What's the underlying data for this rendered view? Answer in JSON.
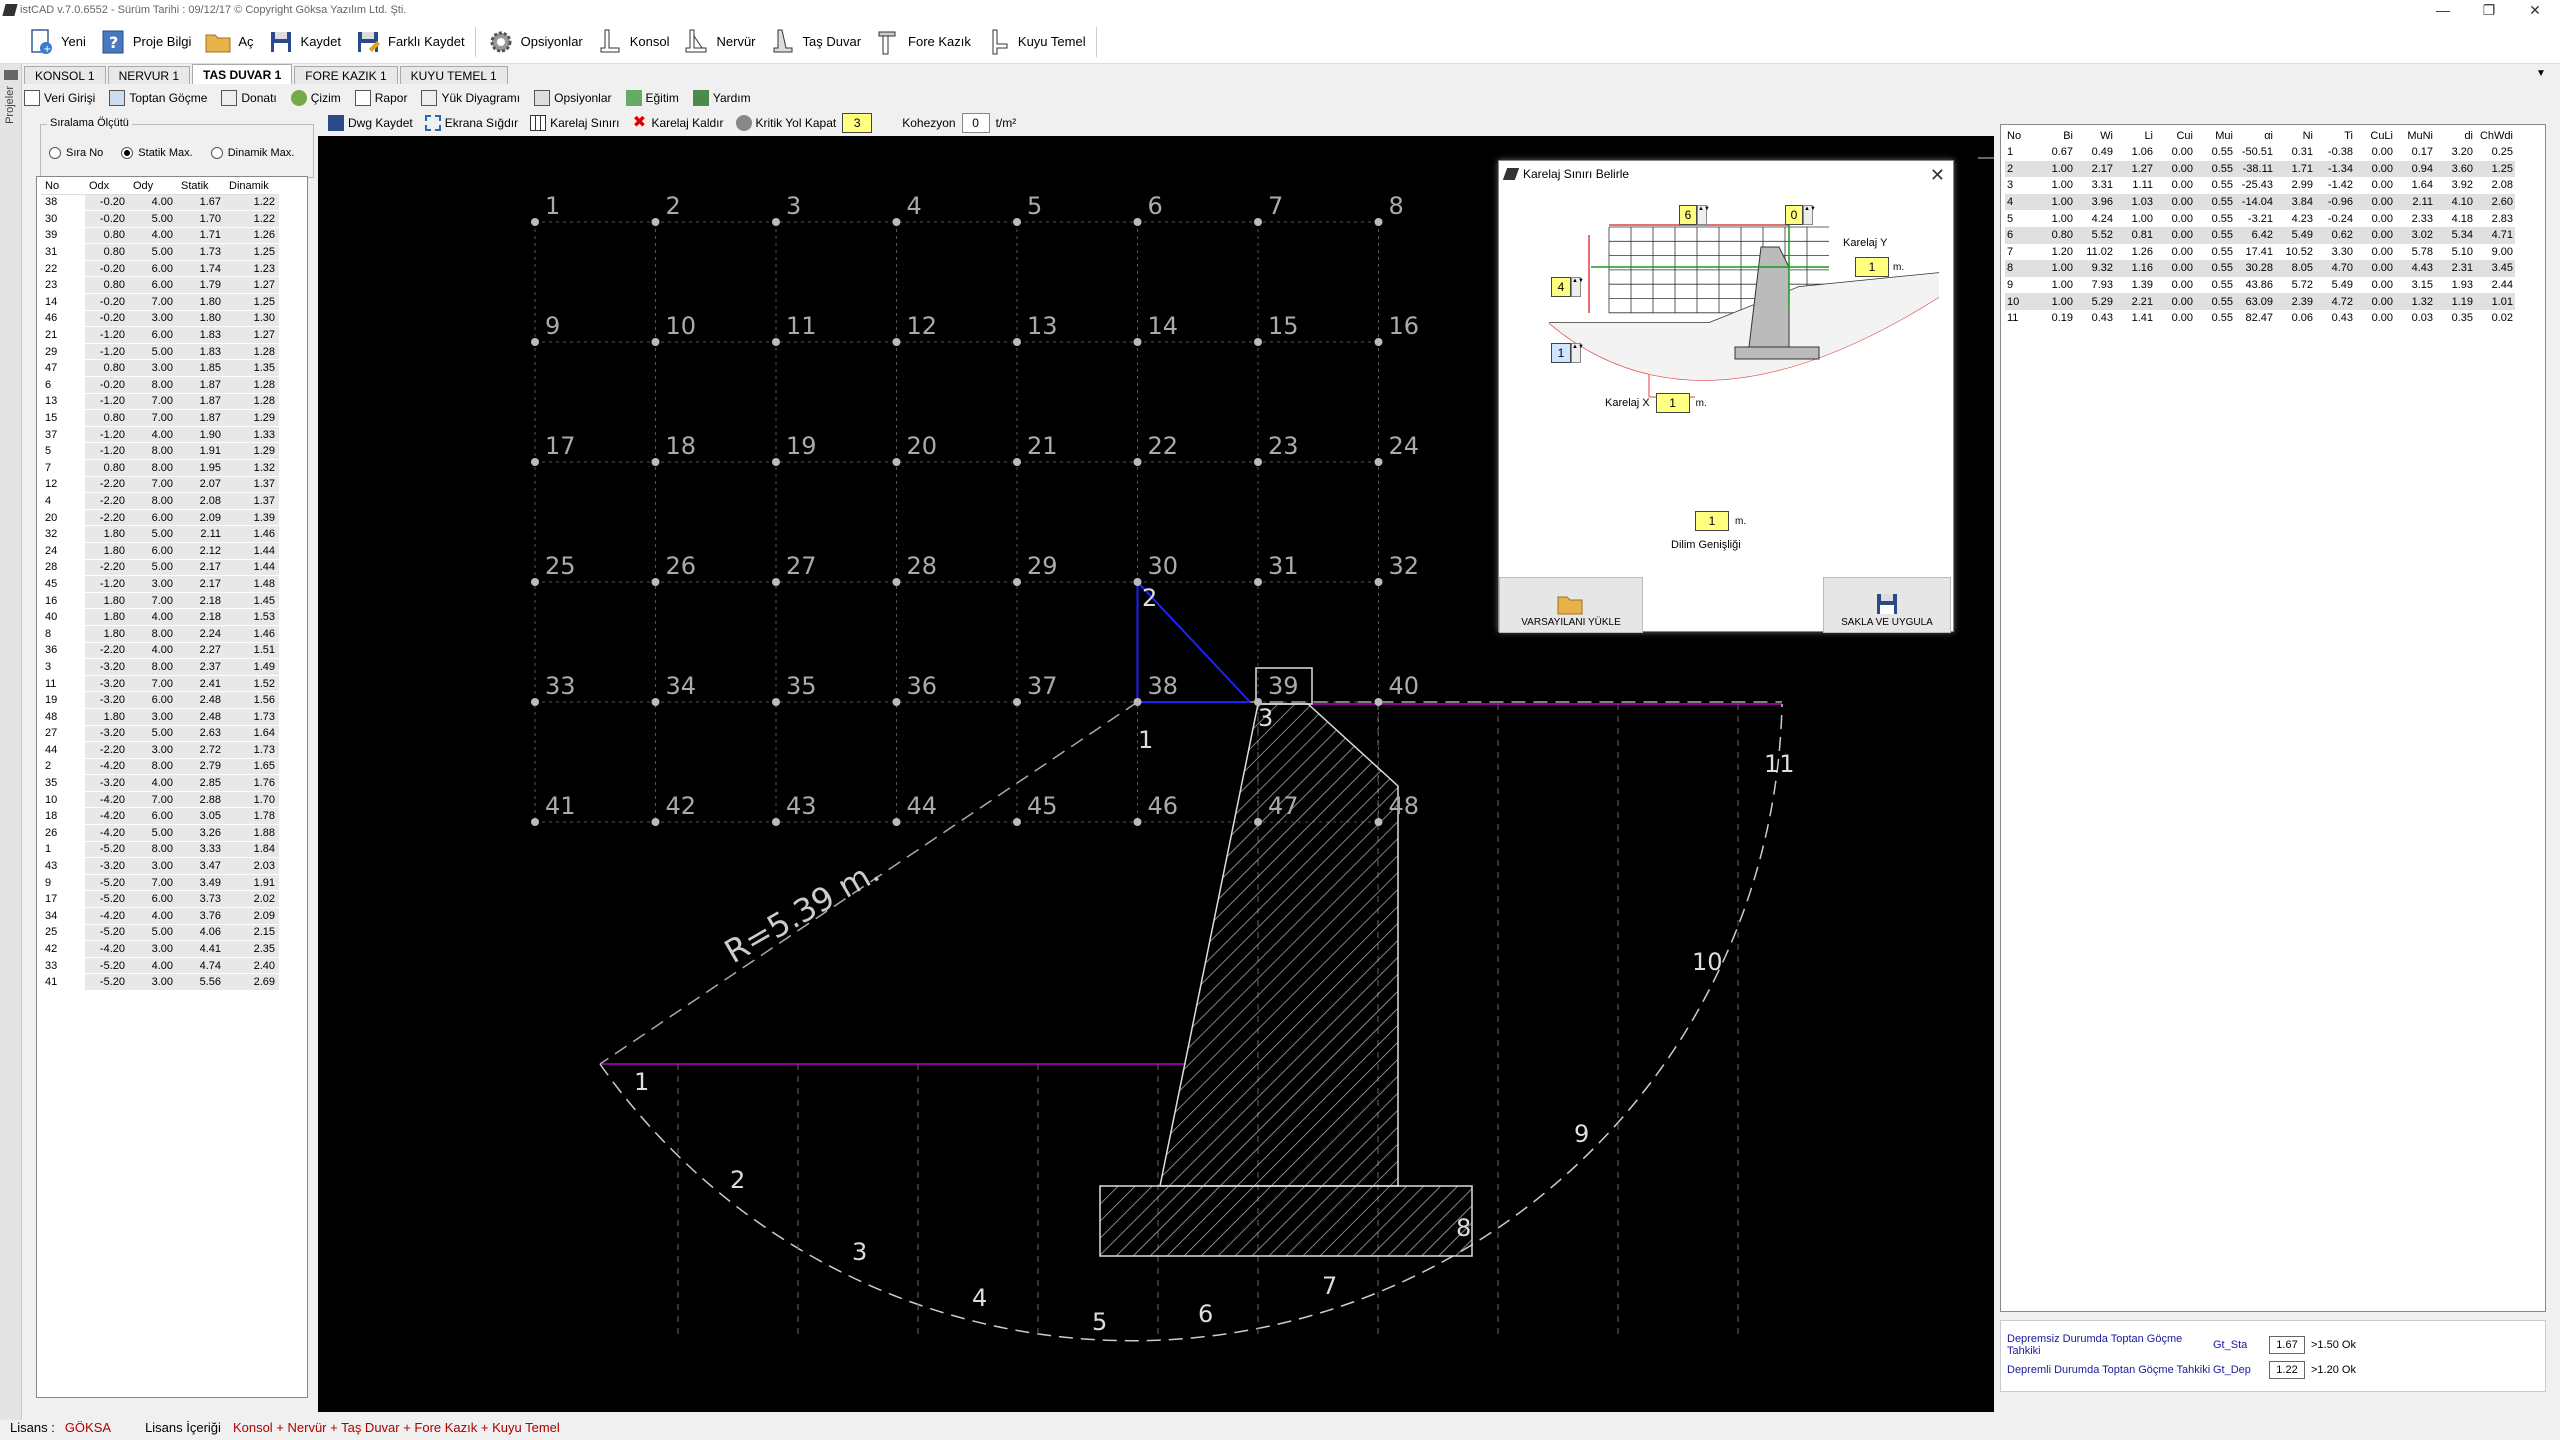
{
  "app": {
    "title": "istCAD v.7.0.6552 - Sürüm Tarihi : 09/12/17  © Copyright Göksa Yazılım Ltd. Şti."
  },
  "toolbar": [
    {
      "id": "yeni",
      "label": "Yeni",
      "icon": "new-document-icon"
    },
    {
      "id": "proje-bilgi",
      "label": "Proje Bilgi",
      "icon": "info-icon"
    },
    {
      "id": "ac",
      "label": "Aç",
      "icon": "folder-open-icon"
    },
    {
      "id": "kaydet",
      "label": "Kaydet",
      "icon": "save-icon"
    },
    {
      "id": "farkli-kaydet",
      "label": "Farklı Kaydet",
      "icon": "save-as-icon"
    },
    {
      "id": "opsiyonlar",
      "label": "Opsiyonlar",
      "icon": "gear-icon"
    },
    {
      "id": "konsol",
      "label": "Konsol",
      "icon": "console-wall-icon"
    },
    {
      "id": "nervur",
      "label": "Nervür",
      "icon": "rib-wall-icon"
    },
    {
      "id": "tas-duvar",
      "label": "Taş Duvar",
      "icon": "stone-wall-icon"
    },
    {
      "id": "fore-kazik",
      "label": "Fore Kazık",
      "icon": "pile-icon"
    },
    {
      "id": "kuyu-temel",
      "label": "Kuyu Temel",
      "icon": "well-foundation-icon"
    }
  ],
  "tabs": [
    "KONSOL 1",
    "NERVUR 1",
    "TAS DUVAR 1",
    "FORE KAZIK 1",
    "KUYU TEMEL 1"
  ],
  "active_tab": "TAS DUVAR 1",
  "subtoolbar": [
    "Veri Girişi",
    "Toptan Göçme",
    "Donatı",
    "Çizim",
    "Rapor",
    "Yük Diyagramı",
    "Opsiyonlar",
    "Eğitim",
    "Yardım"
  ],
  "drawing_toolbar": {
    "items": [
      "Dwg Kaydet",
      "Ekrana Sığdır",
      "Karelaj Sınırı",
      "Karelaj Kaldır",
      "Kritik Yol Kapat"
    ],
    "kritik_value": "3",
    "kohezyon_label": "Kohezyon",
    "kohezyon_value": "0",
    "kohezyon_unit": "t/m²"
  },
  "sorting": {
    "title": "Sıralama Ölçütü",
    "options": [
      "Sıra No",
      "Statik Max.",
      "Dinamik Max."
    ],
    "selected": "Statik Max."
  },
  "left_table": {
    "headers": [
      "No",
      "Odx",
      "Ody",
      "Statik",
      "Dinamik"
    ],
    "rows": [
      [
        "38",
        "-0.20",
        "4.00",
        "1.67",
        "1.22"
      ],
      [
        "30",
        "-0.20",
        "5.00",
        "1.70",
        "1.22"
      ],
      [
        "39",
        "0.80",
        "4.00",
        "1.71",
        "1.26"
      ],
      [
        "31",
        "0.80",
        "5.00",
        "1.73",
        "1.25"
      ],
      [
        "22",
        "-0.20",
        "6.00",
        "1.74",
        "1.23"
      ],
      [
        "23",
        "0.80",
        "6.00",
        "1.79",
        "1.27"
      ],
      [
        "14",
        "-0.20",
        "7.00",
        "1.80",
        "1.25"
      ],
      [
        "46",
        "-0.20",
        "3.00",
        "1.80",
        "1.30"
      ],
      [
        "21",
        "-1.20",
        "6.00",
        "1.83",
        "1.27"
      ],
      [
        "29",
        "-1.20",
        "5.00",
        "1.83",
        "1.28"
      ],
      [
        "47",
        "0.80",
        "3.00",
        "1.85",
        "1.35"
      ],
      [
        "6",
        "-0.20",
        "8.00",
        "1.87",
        "1.28"
      ],
      [
        "13",
        "-1.20",
        "7.00",
        "1.87",
        "1.28"
      ],
      [
        "15",
        "0.80",
        "7.00",
        "1.87",
        "1.29"
      ],
      [
        "37",
        "-1.20",
        "4.00",
        "1.90",
        "1.33"
      ],
      [
        "5",
        "-1.20",
        "8.00",
        "1.91",
        "1.29"
      ],
      [
        "7",
        "0.80",
        "8.00",
        "1.95",
        "1.32"
      ],
      [
        "12",
        "-2.20",
        "7.00",
        "2.07",
        "1.37"
      ],
      [
        "4",
        "-2.20",
        "8.00",
        "2.08",
        "1.37"
      ],
      [
        "20",
        "-2.20",
        "6.00",
        "2.09",
        "1.39"
      ],
      [
        "32",
        "1.80",
        "5.00",
        "2.11",
        "1.46"
      ],
      [
        "24",
        "1.80",
        "6.00",
        "2.12",
        "1.44"
      ],
      [
        "28",
        "-2.20",
        "5.00",
        "2.17",
        "1.44"
      ],
      [
        "45",
        "-1.20",
        "3.00",
        "2.17",
        "1.48"
      ],
      [
        "16",
        "1.80",
        "7.00",
        "2.18",
        "1.45"
      ],
      [
        "40",
        "1.80",
        "4.00",
        "2.18",
        "1.53"
      ],
      [
        "8",
        "1.80",
        "8.00",
        "2.24",
        "1.46"
      ],
      [
        "36",
        "-2.20",
        "4.00",
        "2.27",
        "1.51"
      ],
      [
        "3",
        "-3.20",
        "8.00",
        "2.37",
        "1.49"
      ],
      [
        "11",
        "-3.20",
        "7.00",
        "2.41",
        "1.52"
      ],
      [
        "19",
        "-3.20",
        "6.00",
        "2.48",
        "1.56"
      ],
      [
        "48",
        "1.80",
        "3.00",
        "2.48",
        "1.73"
      ],
      [
        "27",
        "-3.20",
        "5.00",
        "2.63",
        "1.64"
      ],
      [
        "44",
        "-2.20",
        "3.00",
        "2.72",
        "1.73"
      ],
      [
        "2",
        "-4.20",
        "8.00",
        "2.79",
        "1.65"
      ],
      [
        "35",
        "-3.20",
        "4.00",
        "2.85",
        "1.76"
      ],
      [
        "10",
        "-4.20",
        "7.00",
        "2.88",
        "1.70"
      ],
      [
        "18",
        "-4.20",
        "6.00",
        "3.05",
        "1.78"
      ],
      [
        "26",
        "-4.20",
        "5.00",
        "3.26",
        "1.88"
      ],
      [
        "1",
        "-5.20",
        "8.00",
        "3.33",
        "1.84"
      ],
      [
        "43",
        "-3.20",
        "3.00",
        "3.47",
        "2.03"
      ],
      [
        "9",
        "-5.20",
        "7.00",
        "3.49",
        "1.91"
      ],
      [
        "17",
        "-5.20",
        "6.00",
        "3.73",
        "2.02"
      ],
      [
        "34",
        "-4.20",
        "4.00",
        "3.76",
        "2.09"
      ],
      [
        "25",
        "-5.20",
        "5.00",
        "4.06",
        "2.15"
      ],
      [
        "42",
        "-4.20",
        "3.00",
        "4.41",
        "2.35"
      ],
      [
        "33",
        "-5.20",
        "4.00",
        "4.74",
        "2.40"
      ],
      [
        "41",
        "-5.20",
        "3.00",
        "5.56",
        "2.69"
      ]
    ]
  },
  "drawing": {
    "radius_label": "R=5.39 m.",
    "grid_labels": [
      "1",
      "2",
      "3",
      "4",
      "5",
      "6",
      "7",
      "8",
      "9",
      "10",
      "11",
      "12",
      "13",
      "14",
      "15",
      "16",
      "17",
      "18",
      "19",
      "20",
      "21",
      "22",
      "23",
      "24",
      "25",
      "26",
      "27",
      "28",
      "29",
      "30",
      "31",
      "32",
      "33",
      "34",
      "35",
      "36",
      "37",
      "38",
      "39",
      "40",
      "41",
      "42",
      "43",
      "44",
      "45",
      "46",
      "47",
      "48"
    ],
    "slice_labels": [
      "1",
      "2",
      "3",
      "4",
      "5",
      "6",
      "7",
      "8",
      "9",
      "10",
      "11"
    ],
    "path_labels": [
      "1",
      "2",
      "3"
    ]
  },
  "dialog": {
    "title": "Karelaj Sınırı Belirle",
    "top_left_value": "6",
    "top_right_value": "0",
    "karelaj_y_label": "Karelaj Y",
    "karelaj_y_value": "1",
    "left_upper_value": "4",
    "left_lower_value": "1",
    "karelaj_x_label": "Karelaj X",
    "karelaj_x_value": "1",
    "dilim_value": "1",
    "dilim_label": "Dilim Genişliği",
    "unit": "m.",
    "btn_load": "VARSAYILANI YÜKLE",
    "btn_save": "SAKLA VE UYGULA"
  },
  "right_table": {
    "headers": [
      "No",
      "Bi",
      "Wi",
      "Li",
      "Cui",
      "Mui",
      "αi",
      "Ni",
      "Ti",
      "CuLi",
      "MuNi",
      "di",
      "ChWdi"
    ],
    "rows": [
      [
        "1",
        "0.67",
        "0.49",
        "1.06",
        "0.00",
        "0.55",
        "-50.51",
        "0.31",
        "-0.38",
        "0.00",
        "0.17",
        "3.20",
        "0.25"
      ],
      [
        "2",
        "1.00",
        "2.17",
        "1.27",
        "0.00",
        "0.55",
        "-38.11",
        "1.71",
        "-1.34",
        "0.00",
        "0.94",
        "3.60",
        "1.25"
      ],
      [
        "3",
        "1.00",
        "3.31",
        "1.11",
        "0.00",
        "0.55",
        "-25.43",
        "2.99",
        "-1.42",
        "0.00",
        "1.64",
        "3.92",
        "2.08"
      ],
      [
        "4",
        "1.00",
        "3.96",
        "1.03",
        "0.00",
        "0.55",
        "-14.04",
        "3.84",
        "-0.96",
        "0.00",
        "2.11",
        "4.10",
        "2.60"
      ],
      [
        "5",
        "1.00",
        "4.24",
        "1.00",
        "0.00",
        "0.55",
        "-3.21",
        "4.23",
        "-0.24",
        "0.00",
        "2.33",
        "4.18",
        "2.83"
      ],
      [
        "6",
        "0.80",
        "5.52",
        "0.81",
        "0.00",
        "0.55",
        "6.42",
        "5.49",
        "0.62",
        "0.00",
        "3.02",
        "5.34",
        "4.71"
      ],
      [
        "7",
        "1.20",
        "11.02",
        "1.26",
        "0.00",
        "0.55",
        "17.41",
        "10.52",
        "3.30",
        "0.00",
        "5.78",
        "5.10",
        "9.00"
      ],
      [
        "8",
        "1.00",
        "9.32",
        "1.16",
        "0.00",
        "0.55",
        "30.28",
        "8.05",
        "4.70",
        "0.00",
        "4.43",
        "2.31",
        "3.45"
      ],
      [
        "9",
        "1.00",
        "7.93",
        "1.39",
        "0.00",
        "0.55",
        "43.86",
        "5.72",
        "5.49",
        "0.00",
        "3.15",
        "1.93",
        "2.44"
      ],
      [
        "10",
        "1.00",
        "5.29",
        "2.21",
        "0.00",
        "0.55",
        "63.09",
        "2.39",
        "4.72",
        "0.00",
        "1.32",
        "1.19",
        "1.01"
      ],
      [
        "11",
        "0.19",
        "0.43",
        "1.41",
        "0.00",
        "0.55",
        "82.47",
        "0.06",
        "0.43",
        "0.00",
        "0.03",
        "0.35",
        "0.02"
      ]
    ]
  },
  "results": [
    {
      "label": "Depremsiz Durumda Toptan Göçme Tahkiki",
      "key": "Gt_Sta",
      "value": "1.67",
      "check": ">1.50 Ok"
    },
    {
      "label": "Depremli Durumda Toptan Göçme Tahkiki",
      "key": "Gt_Dep",
      "value": "1.22",
      "check": ">1.20 Ok"
    }
  ],
  "status": {
    "lisans_label": "Lisans :",
    "lisans_value": "GÖKSA",
    "icerik_label": "Lisans İçeriği",
    "icerik_value": "Konsol + Nervür + Taş Duvar + Fore Kazık + Kuyu Temel"
  },
  "left_strip_label": "Projeler",
  "colors": {
    "accent_yellow": "#ffff80",
    "canvas_bg": "#000000",
    "result_blue": "#1a1aa0",
    "status_red": "#b00000",
    "slip_line": "#c000c0"
  }
}
